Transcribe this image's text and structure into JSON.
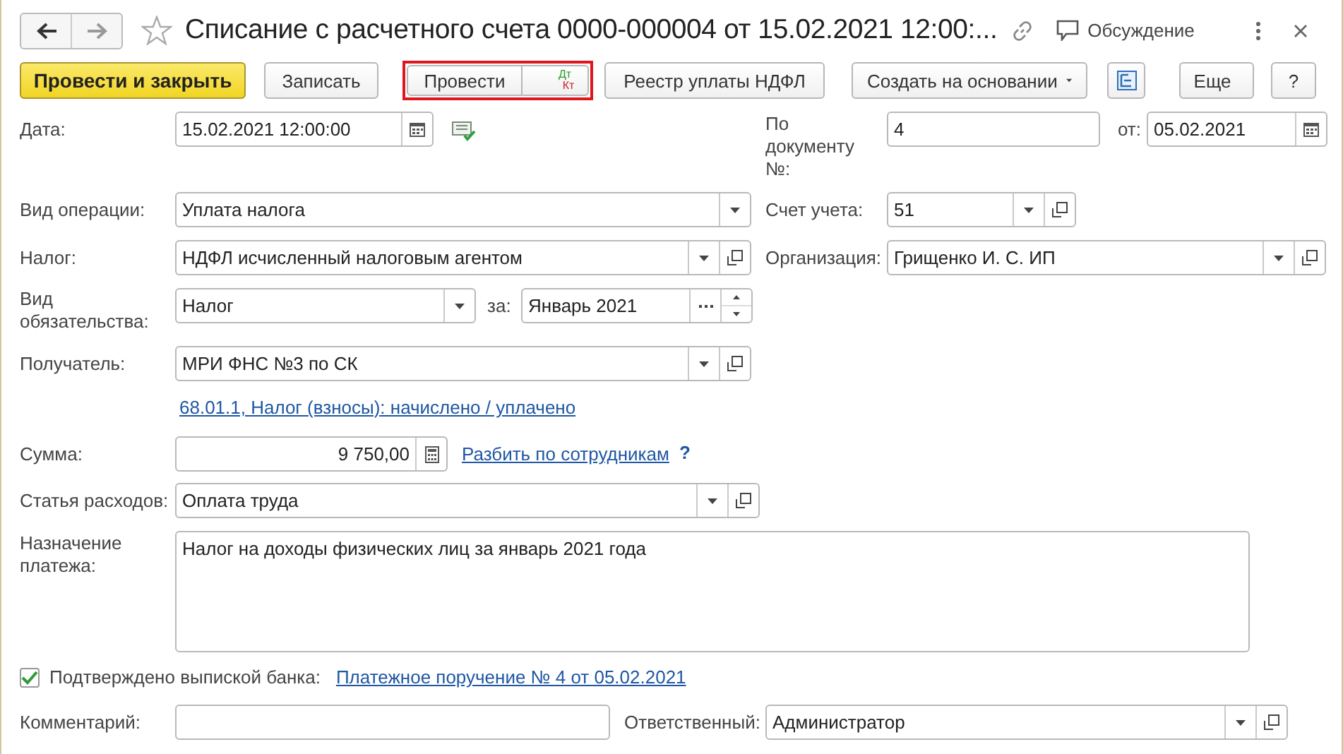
{
  "window": {
    "title": "Списание с расчетного счета 0000-000004 от 15.02.2021 12:00:...",
    "favorite": false,
    "discussion": "Обсуждение"
  },
  "toolbar": [
    {
      "kind": "default",
      "label": "Провести и закрыть"
    },
    {
      "kind": "button",
      "label": "Записать"
    },
    {
      "kind": "post",
      "label": "Провести",
      "dt": "Дт",
      "kt": "Кт",
      "highlighted": true
    },
    {
      "kind": "button",
      "label": "Реестр уплаты НДФЛ"
    },
    {
      "kind": "menu",
      "label": "Создать на основании"
    },
    {
      "kind": "structure"
    },
    {
      "kind": "menu",
      "label": "Еще"
    },
    {
      "kind": "button",
      "label": "?"
    }
  ],
  "fields": {
    "date": {
      "label": "Дата:",
      "value": "15.02.2021 12:00:00",
      "buttons": [
        {
          "kind": "calendar"
        }
      ]
    },
    "doc_number": {
      "label": "По документу №:",
      "value": "4"
    },
    "doc_date": {
      "label": "от:",
      "value": "05.02.2021",
      "buttons": [
        {
          "kind": "calendar"
        }
      ]
    },
    "operation": {
      "label": "Вид операции:",
      "value": "Уплата налога",
      "buttons": [
        {
          "kind": "dropdown"
        }
      ]
    },
    "account": {
      "label": "Счет учета:",
      "value": "51",
      "buttons": [
        {
          "kind": "dropdown"
        },
        {
          "kind": "open"
        }
      ]
    },
    "tax": {
      "label": "Налог:",
      "value": "НДФЛ исчисленный налоговым агентом",
      "buttons": [
        {
          "kind": "dropdown"
        },
        {
          "kind": "open"
        }
      ]
    },
    "organization": {
      "label": "Организация:",
      "value": "Грищенко И. С. ИП",
      "buttons": [
        {
          "kind": "dropdown"
        },
        {
          "kind": "open"
        }
      ]
    },
    "obligation": {
      "label": "Вид обязательства:",
      "value": "Налог",
      "buttons": [
        {
          "kind": "dropdown"
        }
      ]
    },
    "period": {
      "label": "за:",
      "value": "Январь 2021",
      "buttons": [
        {
          "kind": "choice"
        },
        {
          "kind": "spin"
        }
      ]
    },
    "recipient": {
      "label": "Получатель:",
      "value": "МРИ ФНС №3 по СК",
      "buttons": [
        {
          "kind": "dropdown"
        },
        {
          "kind": "open"
        }
      ]
    },
    "amount": {
      "label": "Сумма:",
      "value": "9 750,00",
      "buttons": [
        {
          "kind": "calculator"
        }
      ]
    },
    "expense_item": {
      "label": "Статья расходов:",
      "value": "Оплата труда",
      "buttons": [
        {
          "kind": "dropdown"
        },
        {
          "kind": "open"
        }
      ]
    },
    "purpose": {
      "label": "Назначение платежа:",
      "value": "Налог на доходы физических лиц за январь 2021 года"
    },
    "comment": {
      "label": "Комментарий:"
    },
    "responsible": {
      "label": "Ответственный:",
      "value": "Администратор",
      "buttons": [
        {
          "kind": "dropdown"
        },
        {
          "kind": "open"
        }
      ]
    }
  },
  "account_link": "68.01.1, Налог (взносы): начислено / уплачено",
  "split_link": "Разбить по сотрудникам",
  "split_help": "?",
  "confirmed": {
    "label": "Подтверждено выпиской банка:",
    "checked": true
  },
  "payment_order_link": "Платежное поручение № 4 от 05.02.2021"
}
